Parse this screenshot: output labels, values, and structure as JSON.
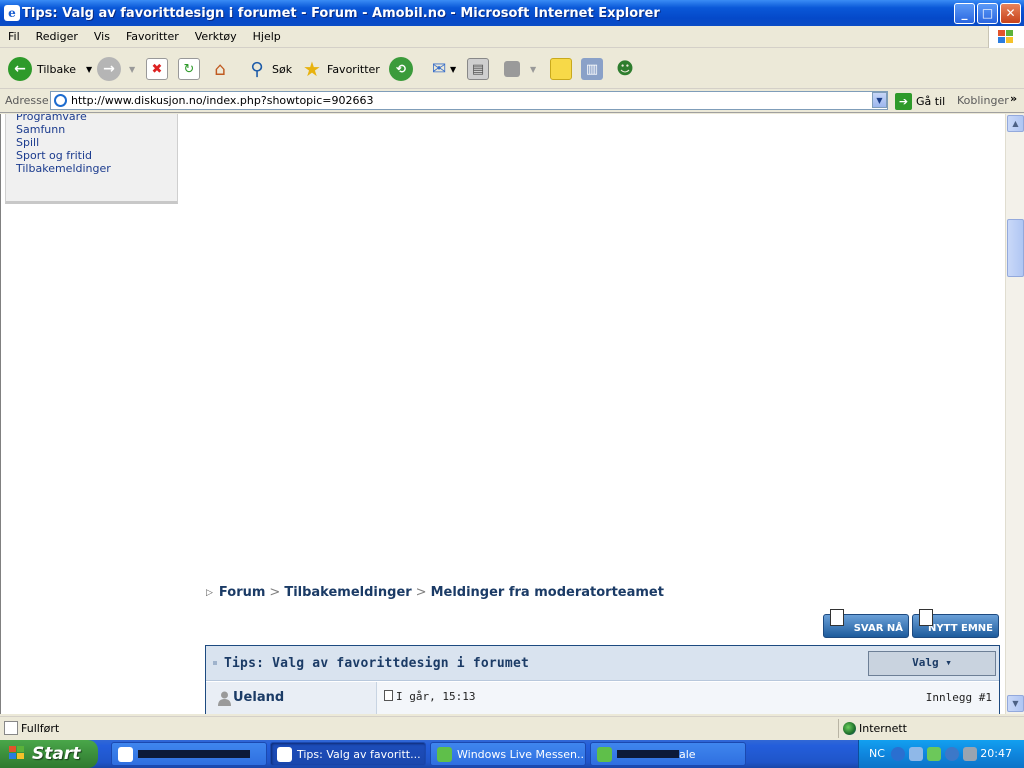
{
  "window": {
    "title": "Tips: Valg av favorittdesign i forumet - Forum - Amobil.no - Microsoft Internet Explorer",
    "minimize": "_",
    "maximize": "□",
    "close": "✕"
  },
  "menu": {
    "items": [
      "Fil",
      "Rediger",
      "Vis",
      "Favoritter",
      "Verktøy",
      "Hjelp"
    ]
  },
  "toolbar": {
    "back_label": "Tilbake",
    "search_label": "Søk",
    "favorites_label": "Favoritter"
  },
  "address": {
    "label": "Adresse",
    "url": "http://www.diskusjon.no/index.php?showtopic=902663",
    "go_label": "Gå til",
    "links_label": "Koblinger"
  },
  "sidebar": {
    "links": [
      "Programvare",
      "Samfunn",
      "Spill",
      "Sport og fritid",
      "Tilbakemeldinger"
    ]
  },
  "breadcrumb": {
    "items": [
      "Forum",
      "Tilbakemeldinger",
      "Meldinger fra moderatorteamet"
    ],
    "separator": ">"
  },
  "buttons": {
    "reply": "SVAR NÅ",
    "new_topic": "NYTT EMNE"
  },
  "topic": {
    "title": "Tips: Valg av favorittdesign i forumet",
    "options_label": "Valg ▾"
  },
  "post": {
    "author": "Ueland",
    "date": "I går, 15:13",
    "number": "Innlegg #1"
  },
  "status": {
    "text": "Fullført",
    "zone": "Internett"
  },
  "taskbar": {
    "start_label": "Start",
    "tasks": [
      {
        "label": "",
        "active": false
      },
      {
        "label": "Tips: Valg av favoritt...",
        "active": true
      },
      {
        "label": "Windows Live Messen...",
        "active": false
      },
      {
        "label": "ale",
        "active": false
      }
    ],
    "lang": "NC",
    "clock": "20:47"
  },
  "colors": {
    "link": "#1b3b8e",
    "forum_heading": "#1b3b66",
    "titlebar": "#0a58d8",
    "start_green": "#3c8f3c"
  }
}
